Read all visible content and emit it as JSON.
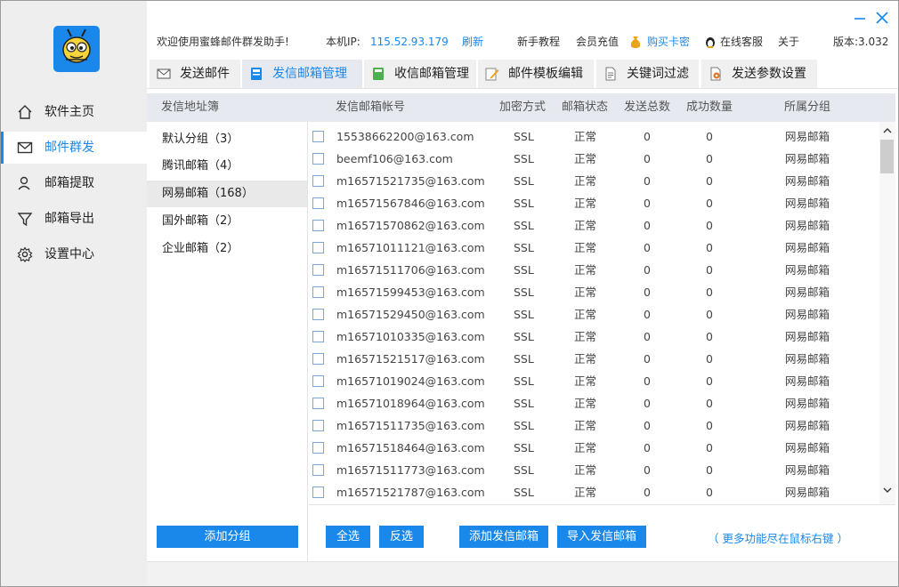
{
  "colors": {
    "accent": "#1a88ea",
    "sidebar_bg": "#eeeeee",
    "header_bg": "#e6eaf0"
  },
  "sidebar": {
    "logo_icon": "bee-icon",
    "items": [
      {
        "label": "软件主页",
        "icon": "home-icon"
      },
      {
        "label": "邮件群发",
        "icon": "mail-icon",
        "active": true
      },
      {
        "label": "邮箱提取",
        "icon": "user-icon"
      },
      {
        "label": "邮箱导出",
        "icon": "filter-icon"
      },
      {
        "label": "设置中心",
        "icon": "gear-icon"
      }
    ]
  },
  "header": {
    "welcome": "欢迎使用蜜蜂邮件群发助手!",
    "ip_label": "本机IP:",
    "ip_value": "115.52.93.179",
    "refresh": "刷新",
    "tutorial": "新手教程",
    "recharge": "会员充值",
    "buy_card": "购买卡密",
    "support": "在线客服",
    "about": "关于",
    "version": "版本:3.032"
  },
  "tabs": [
    {
      "label": "发送邮件",
      "icon": "send-mail-icon"
    },
    {
      "label": "发信邮箱管理",
      "icon": "mailbox-icon",
      "active": true
    },
    {
      "label": "收信邮箱管理",
      "icon": "inbox-icon"
    },
    {
      "label": "邮件模板编辑",
      "icon": "edit-icon"
    },
    {
      "label": "关键词过滤",
      "icon": "document-icon"
    },
    {
      "label": "发送参数设置",
      "icon": "settings-icon"
    }
  ],
  "groups": {
    "header": "发信地址簿",
    "items": [
      {
        "label": "默认分组（3）"
      },
      {
        "label": "腾讯邮箱（4）"
      },
      {
        "label": "网易邮箱（168）",
        "active": true
      },
      {
        "label": "国外邮箱（2）"
      },
      {
        "label": "企业邮箱（2）"
      }
    ],
    "add_button": "添加分组"
  },
  "table": {
    "columns": [
      "发信邮箱帐号",
      "加密方式",
      "邮箱状态",
      "发送总数",
      "成功数量",
      "所属分组"
    ],
    "rows": [
      [
        "15538662200@163.com",
        "SSL",
        "正常",
        "0",
        "0",
        "网易邮箱"
      ],
      [
        "beemf106@163.com",
        "SSL",
        "正常",
        "0",
        "0",
        "网易邮箱"
      ],
      [
        "m16571521735@163.com",
        "SSL",
        "正常",
        "0",
        "0",
        "网易邮箱"
      ],
      [
        "m16571567846@163.com",
        "SSL",
        "正常",
        "0",
        "0",
        "网易邮箱"
      ],
      [
        "m16571570862@163.com",
        "SSL",
        "正常",
        "0",
        "0",
        "网易邮箱"
      ],
      [
        "m16571011121@163.com",
        "SSL",
        "正常",
        "0",
        "0",
        "网易邮箱"
      ],
      [
        "m16571511706@163.com",
        "SSL",
        "正常",
        "0",
        "0",
        "网易邮箱"
      ],
      [
        "m16571599453@163.com",
        "SSL",
        "正常",
        "0",
        "0",
        "网易邮箱"
      ],
      [
        "m16571529450@163.com",
        "SSL",
        "正常",
        "0",
        "0",
        "网易邮箱"
      ],
      [
        "m16571010335@163.com",
        "SSL",
        "正常",
        "0",
        "0",
        "网易邮箱"
      ],
      [
        "m16571521517@163.com",
        "SSL",
        "正常",
        "0",
        "0",
        "网易邮箱"
      ],
      [
        "m16571019024@163.com",
        "SSL",
        "正常",
        "0",
        "0",
        "网易邮箱"
      ],
      [
        "m16571018964@163.com",
        "SSL",
        "正常",
        "0",
        "0",
        "网易邮箱"
      ],
      [
        "m16571511735@163.com",
        "SSL",
        "正常",
        "0",
        "0",
        "网易邮箱"
      ],
      [
        "m16571518464@163.com",
        "SSL",
        "正常",
        "0",
        "0",
        "网易邮箱"
      ],
      [
        "m16571511773@163.com",
        "SSL",
        "正常",
        "0",
        "0",
        "网易邮箱"
      ],
      [
        "m16571521787@163.com",
        "SSL",
        "正常",
        "0",
        "0",
        "网易邮箱"
      ]
    ]
  },
  "actions": {
    "select_all": "全选",
    "invert": "反选",
    "add_sender": "添加发信邮箱",
    "import_sender": "导入发信邮箱",
    "hint": "（ 更多功能尽在鼠标右键 ）"
  }
}
